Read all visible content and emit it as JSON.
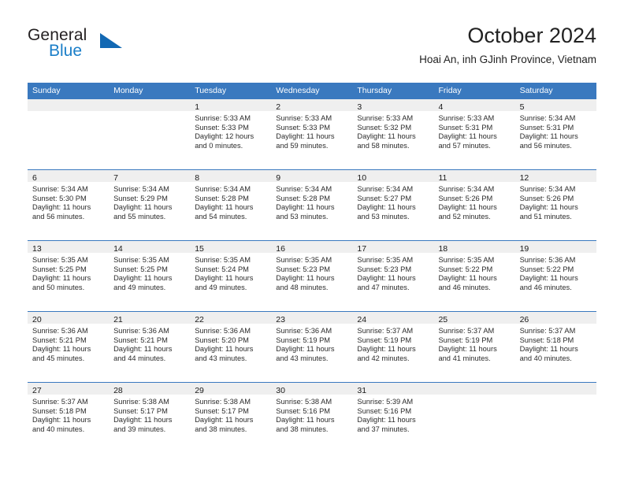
{
  "brand": {
    "name_top": "General",
    "name_bottom": "Blue",
    "accent_color": "#1268b3",
    "text_color": "#231f20"
  },
  "header": {
    "month_title": "October 2024",
    "location": "Hoai An, inh GJinh Province, Vietnam"
  },
  "theme": {
    "header_band": "#3a79bf",
    "day_band": "#efefef",
    "rule": "#3a79bf",
    "body_text": "#2b2b2b"
  },
  "weekdays": [
    "Sunday",
    "Monday",
    "Tuesday",
    "Wednesday",
    "Thursday",
    "Friday",
    "Saturday"
  ],
  "weeks": [
    [
      {
        "day": "",
        "lines": []
      },
      {
        "day": "",
        "lines": []
      },
      {
        "day": "1",
        "lines": [
          "Sunrise: 5:33 AM",
          "Sunset: 5:33 PM",
          "Daylight: 12 hours",
          "and 0 minutes."
        ]
      },
      {
        "day": "2",
        "lines": [
          "Sunrise: 5:33 AM",
          "Sunset: 5:33 PM",
          "Daylight: 11 hours",
          "and 59 minutes."
        ]
      },
      {
        "day": "3",
        "lines": [
          "Sunrise: 5:33 AM",
          "Sunset: 5:32 PM",
          "Daylight: 11 hours",
          "and 58 minutes."
        ]
      },
      {
        "day": "4",
        "lines": [
          "Sunrise: 5:33 AM",
          "Sunset: 5:31 PM",
          "Daylight: 11 hours",
          "and 57 minutes."
        ]
      },
      {
        "day": "5",
        "lines": [
          "Sunrise: 5:34 AM",
          "Sunset: 5:31 PM",
          "Daylight: 11 hours",
          "and 56 minutes."
        ]
      }
    ],
    [
      {
        "day": "6",
        "lines": [
          "Sunrise: 5:34 AM",
          "Sunset: 5:30 PM",
          "Daylight: 11 hours",
          "and 56 minutes."
        ]
      },
      {
        "day": "7",
        "lines": [
          "Sunrise: 5:34 AM",
          "Sunset: 5:29 PM",
          "Daylight: 11 hours",
          "and 55 minutes."
        ]
      },
      {
        "day": "8",
        "lines": [
          "Sunrise: 5:34 AM",
          "Sunset: 5:28 PM",
          "Daylight: 11 hours",
          "and 54 minutes."
        ]
      },
      {
        "day": "9",
        "lines": [
          "Sunrise: 5:34 AM",
          "Sunset: 5:28 PM",
          "Daylight: 11 hours",
          "and 53 minutes."
        ]
      },
      {
        "day": "10",
        "lines": [
          "Sunrise: 5:34 AM",
          "Sunset: 5:27 PM",
          "Daylight: 11 hours",
          "and 53 minutes."
        ]
      },
      {
        "day": "11",
        "lines": [
          "Sunrise: 5:34 AM",
          "Sunset: 5:26 PM",
          "Daylight: 11 hours",
          "and 52 minutes."
        ]
      },
      {
        "day": "12",
        "lines": [
          "Sunrise: 5:34 AM",
          "Sunset: 5:26 PM",
          "Daylight: 11 hours",
          "and 51 minutes."
        ]
      }
    ],
    [
      {
        "day": "13",
        "lines": [
          "Sunrise: 5:35 AM",
          "Sunset: 5:25 PM",
          "Daylight: 11 hours",
          "and 50 minutes."
        ]
      },
      {
        "day": "14",
        "lines": [
          "Sunrise: 5:35 AM",
          "Sunset: 5:25 PM",
          "Daylight: 11 hours",
          "and 49 minutes."
        ]
      },
      {
        "day": "15",
        "lines": [
          "Sunrise: 5:35 AM",
          "Sunset: 5:24 PM",
          "Daylight: 11 hours",
          "and 49 minutes."
        ]
      },
      {
        "day": "16",
        "lines": [
          "Sunrise: 5:35 AM",
          "Sunset: 5:23 PM",
          "Daylight: 11 hours",
          "and 48 minutes."
        ]
      },
      {
        "day": "17",
        "lines": [
          "Sunrise: 5:35 AM",
          "Sunset: 5:23 PM",
          "Daylight: 11 hours",
          "and 47 minutes."
        ]
      },
      {
        "day": "18",
        "lines": [
          "Sunrise: 5:35 AM",
          "Sunset: 5:22 PM",
          "Daylight: 11 hours",
          "and 46 minutes."
        ]
      },
      {
        "day": "19",
        "lines": [
          "Sunrise: 5:36 AM",
          "Sunset: 5:22 PM",
          "Daylight: 11 hours",
          "and 46 minutes."
        ]
      }
    ],
    [
      {
        "day": "20",
        "lines": [
          "Sunrise: 5:36 AM",
          "Sunset: 5:21 PM",
          "Daylight: 11 hours",
          "and 45 minutes."
        ]
      },
      {
        "day": "21",
        "lines": [
          "Sunrise: 5:36 AM",
          "Sunset: 5:21 PM",
          "Daylight: 11 hours",
          "and 44 minutes."
        ]
      },
      {
        "day": "22",
        "lines": [
          "Sunrise: 5:36 AM",
          "Sunset: 5:20 PM",
          "Daylight: 11 hours",
          "and 43 minutes."
        ]
      },
      {
        "day": "23",
        "lines": [
          "Sunrise: 5:36 AM",
          "Sunset: 5:19 PM",
          "Daylight: 11 hours",
          "and 43 minutes."
        ]
      },
      {
        "day": "24",
        "lines": [
          "Sunrise: 5:37 AM",
          "Sunset: 5:19 PM",
          "Daylight: 11 hours",
          "and 42 minutes."
        ]
      },
      {
        "day": "25",
        "lines": [
          "Sunrise: 5:37 AM",
          "Sunset: 5:19 PM",
          "Daylight: 11 hours",
          "and 41 minutes."
        ]
      },
      {
        "day": "26",
        "lines": [
          "Sunrise: 5:37 AM",
          "Sunset: 5:18 PM",
          "Daylight: 11 hours",
          "and 40 minutes."
        ]
      }
    ],
    [
      {
        "day": "27",
        "lines": [
          "Sunrise: 5:37 AM",
          "Sunset: 5:18 PM",
          "Daylight: 11 hours",
          "and 40 minutes."
        ]
      },
      {
        "day": "28",
        "lines": [
          "Sunrise: 5:38 AM",
          "Sunset: 5:17 PM",
          "Daylight: 11 hours",
          "and 39 minutes."
        ]
      },
      {
        "day": "29",
        "lines": [
          "Sunrise: 5:38 AM",
          "Sunset: 5:17 PM",
          "Daylight: 11 hours",
          "and 38 minutes."
        ]
      },
      {
        "day": "30",
        "lines": [
          "Sunrise: 5:38 AM",
          "Sunset: 5:16 PM",
          "Daylight: 11 hours",
          "and 38 minutes."
        ]
      },
      {
        "day": "31",
        "lines": [
          "Sunrise: 5:39 AM",
          "Sunset: 5:16 PM",
          "Daylight: 11 hours",
          "and 37 minutes."
        ]
      },
      {
        "day": "",
        "lines": []
      },
      {
        "day": "",
        "lines": []
      }
    ]
  ]
}
